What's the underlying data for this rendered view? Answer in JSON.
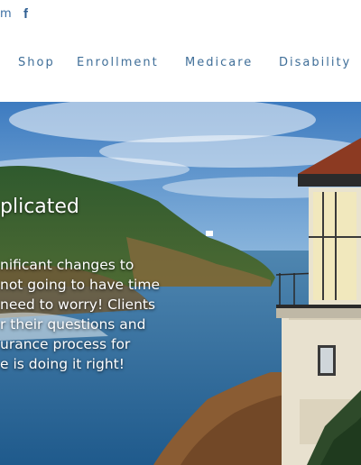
{
  "header": {
    "email_fragment": "m",
    "facebook_icon": "facebook-icon"
  },
  "nav": {
    "items": [
      "Shop",
      "Enrollment",
      "Medicare",
      "Disability"
    ]
  },
  "hero": {
    "heading": "plicated",
    "lines": [
      "nificant changes to",
      "not going to have time",
      "need to worry! Clients",
      "r their questions and",
      "urance process for",
      "e is doing it right!"
    ],
    "image": "lighthouse-coastline-photo"
  },
  "colors": {
    "nav_text": "#3f6e98",
    "header_icon": "#2f5f93",
    "hero_text": "#ffffff"
  }
}
